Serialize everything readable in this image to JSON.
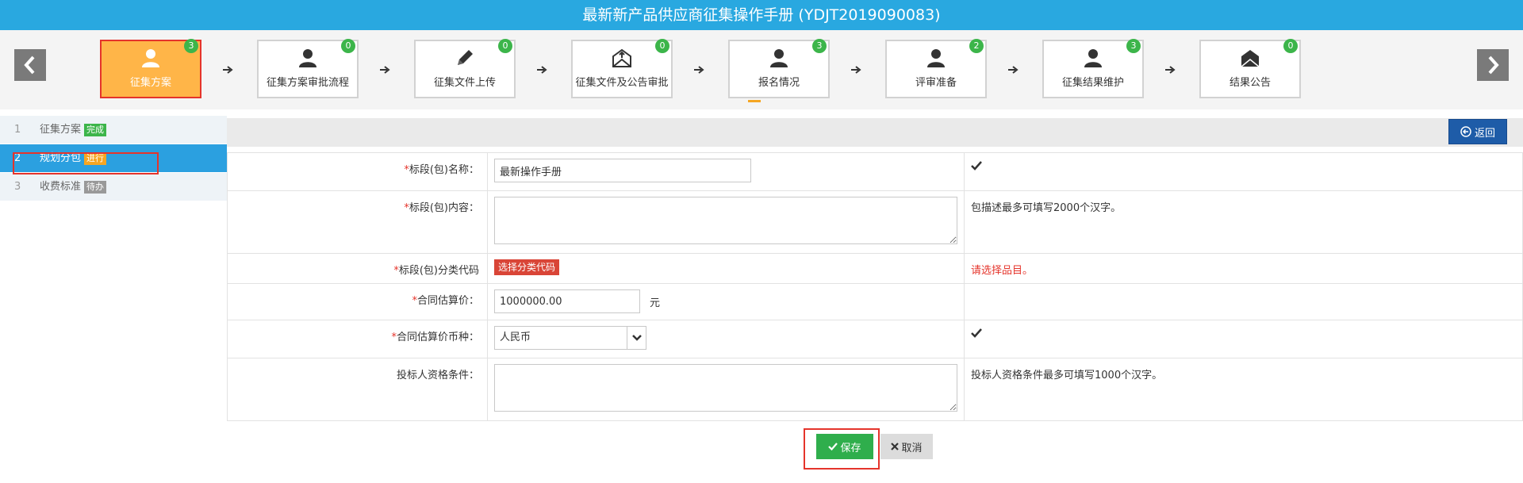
{
  "title": "最新新产品供应商征集操作手册 (YDJT2019090083)",
  "steps": [
    {
      "label": "征集方案",
      "badge": "3",
      "icon": "user-icon",
      "active": true
    },
    {
      "label": "征集方案审批流程",
      "badge": "0",
      "icon": "user-icon",
      "active": false
    },
    {
      "label": "征集文件上传",
      "badge": "0",
      "icon": "pencil-icon",
      "active": false
    },
    {
      "label": "征集文件及公告审批",
      "badge": "0",
      "icon": "envelope-upload-icon",
      "active": false
    },
    {
      "label": "报名情况",
      "badge": "3",
      "icon": "user-icon",
      "active": false
    },
    {
      "label": "评审准备",
      "badge": "2",
      "icon": "user-icon",
      "active": false
    },
    {
      "label": "征集结果维护",
      "badge": "3",
      "icon": "user-icon",
      "active": false
    },
    {
      "label": "结果公告",
      "badge": "0",
      "icon": "envelope-icon",
      "active": false
    }
  ],
  "sidebar": {
    "items": [
      {
        "num": "1",
        "label": "征集方案",
        "tag": "完成",
        "tag_color": "#3cb54a"
      },
      {
        "num": "2",
        "label": "规划分包",
        "tag": "进行",
        "tag_color": "#f5a623"
      },
      {
        "num": "3",
        "label": "收费标准",
        "tag": "待办",
        "tag_color": "#999999"
      }
    ]
  },
  "back_label": "返回",
  "form": {
    "req_mark": "*",
    "name_label": "标段(包)名称：",
    "name_value": "最新操作手册",
    "content_label": "标段(包)内容：",
    "content_hint": "包描述最多可填写2000个汉字。",
    "code_label": "标段(包)分类代码",
    "code_button": "选择分类代码",
    "code_error": "请选择品目。",
    "price_label": "合同估算价：",
    "price_value": "1000000.00",
    "price_unit": "元",
    "currency_label": "合同估算价币种：",
    "currency_value": "人民币",
    "qual_label": "投标人资格条件：",
    "qual_hint": "投标人资格条件最多可填写1000个汉字。"
  },
  "actions": {
    "save_label": "保存",
    "cancel_label": "取消"
  },
  "colors": {
    "title_bar": "#29a8e0",
    "active_step": "#ffb548",
    "highlight": "#e5342b",
    "save": "#2fae4c",
    "back": "#1e5ca8"
  }
}
